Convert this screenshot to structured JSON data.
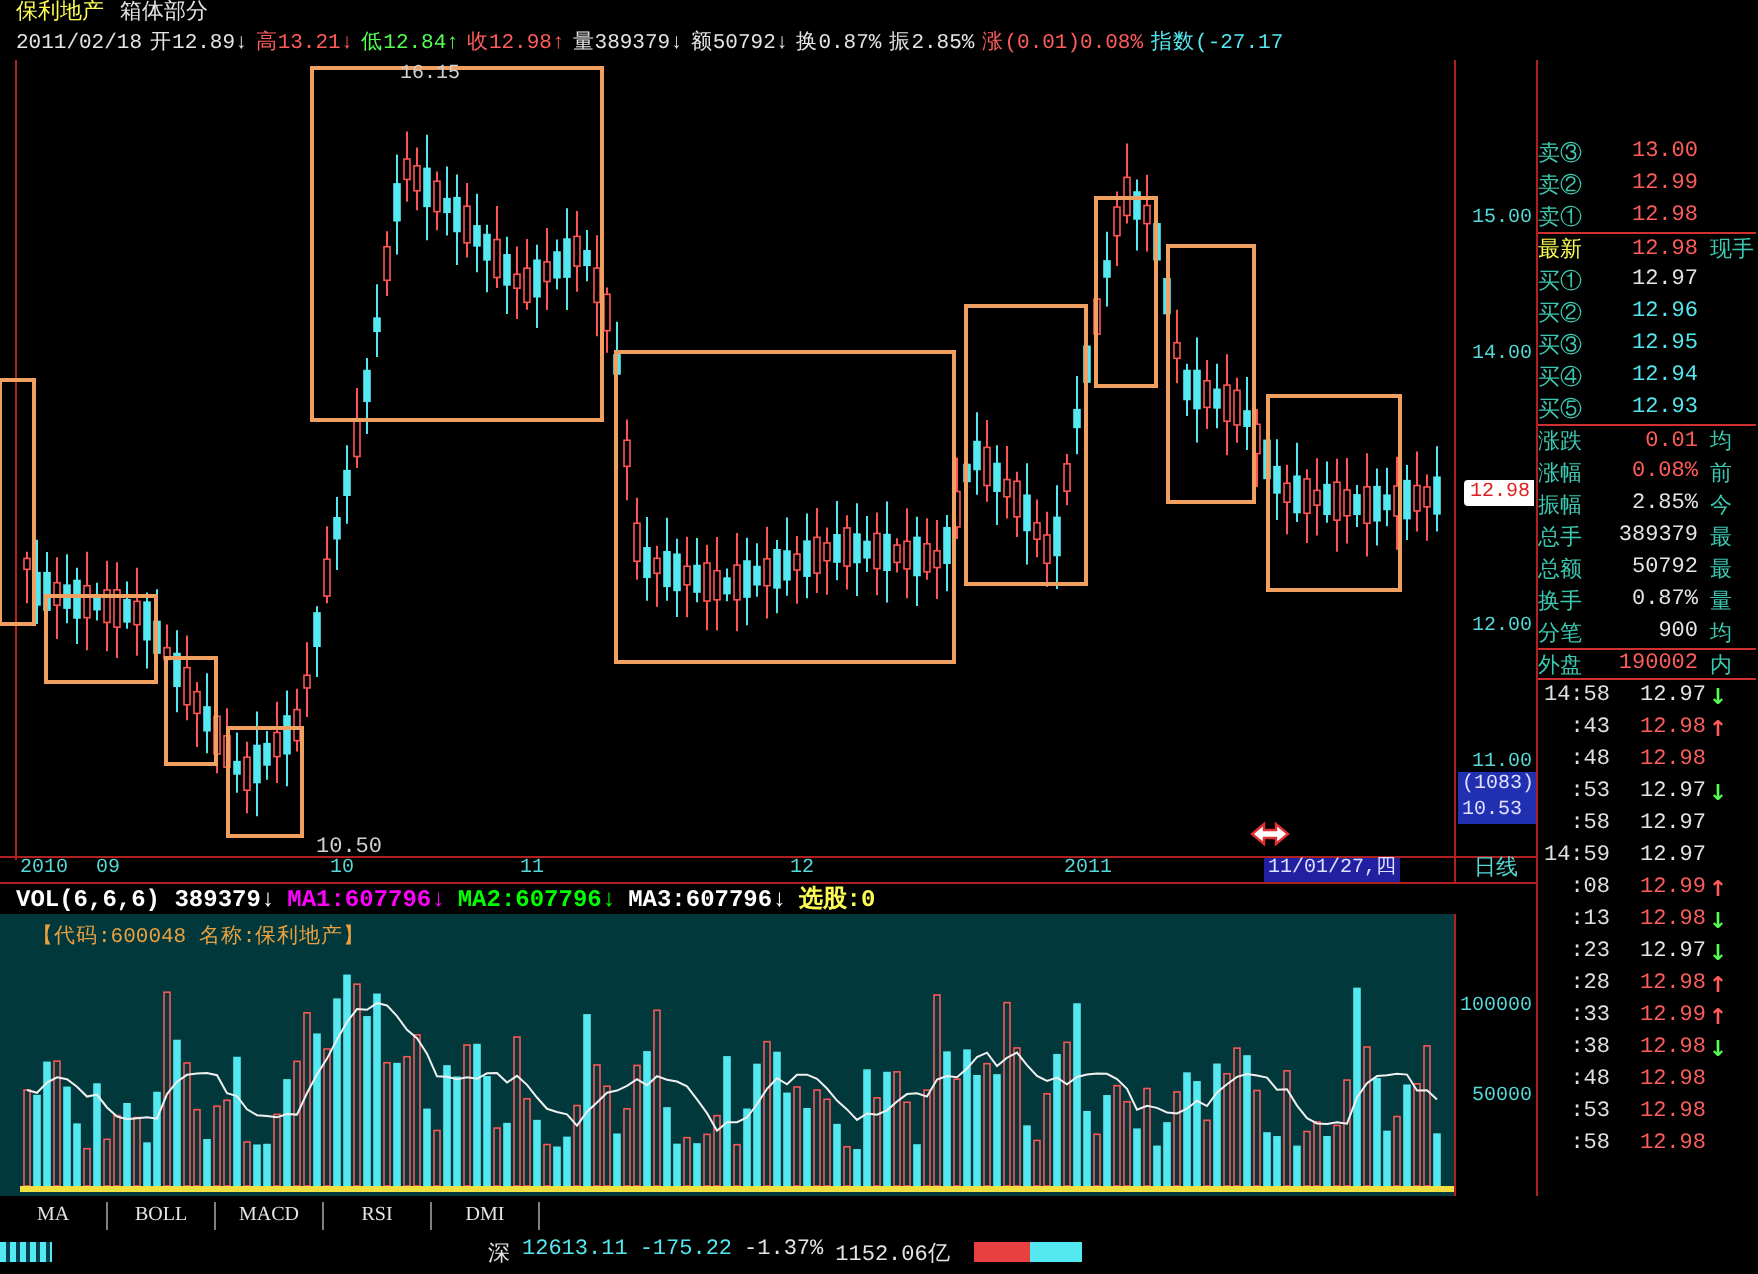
{
  "header": {
    "title": "保利地产",
    "subtitle": "箱体部分",
    "quote": [
      {
        "text": "2011/02/18",
        "color": "#e4e4e4"
      },
      {
        "text": "开12.89↓",
        "color": "#e4e4e4"
      },
      {
        "text": "高13.21↓",
        "color": "#ff5c5c"
      },
      {
        "text": "低12.84↑",
        "color": "#54fc54"
      },
      {
        "text": "收12.98↑",
        "color": "#ff5c5c"
      },
      {
        "text": "量389379↓",
        "color": "#e4e4e4"
      },
      {
        "text": "额50792↓",
        "color": "#e4e4e4"
      },
      {
        "text": "换0.87%",
        "color": "#e4e4e4"
      },
      {
        "text": "振2.85%",
        "color": "#e4e4e4"
      },
      {
        "text": "涨(0.01)0.08%",
        "color": "#ff5c5c"
      },
      {
        "text": "指数(-27.17",
        "color": "#54e8f0"
      }
    ]
  },
  "chart": {
    "high_label": "16.15",
    "low_label": "10.50",
    "price_ticks": [
      "15.00",
      "14.00",
      "12.00",
      "11.00"
    ],
    "last_price": "12.98",
    "cursor_info": [
      "(1083)",
      "10.53"
    ],
    "dates": [
      "2010",
      "09",
      "10",
      "11",
      "12",
      "2011"
    ],
    "cursor_date": "11/01/27,四",
    "period": "日线"
  },
  "volume": {
    "indicator": [
      {
        "text": "VOL(6,6,6) 389379↓",
        "color": "#ffffff"
      },
      {
        "text": "MA1:607796↓",
        "color": "#ff00ff"
      },
      {
        "text": "MA2:607796↓",
        "color": "#00ff00"
      },
      {
        "text": "MA3:607796↓",
        "color": "#ffffff"
      },
      {
        "text": "选股:0",
        "color": "#fcfc54"
      }
    ],
    "caption": "【代码:600048 名称:保利地产】",
    "ticks": [
      "100000",
      "50000"
    ]
  },
  "panel": {
    "asks": [
      {
        "label": "卖③",
        "value": "13.00",
        "color": "#ff5c5c"
      },
      {
        "label": "卖②",
        "value": "12.99",
        "color": "#ff5c5c"
      },
      {
        "label": "卖①",
        "value": "12.98",
        "color": "#ff5c5c"
      }
    ],
    "latest": {
      "label": "最新",
      "value": "12.98",
      "color": "#ff5c5c",
      "side": "现手"
    },
    "bids": [
      {
        "label": "买①",
        "value": "12.97",
        "color": "#e4e4e4"
      },
      {
        "label": "买②",
        "value": "12.96",
        "color": "#54e8f0"
      },
      {
        "label": "买③",
        "value": "12.95",
        "color": "#54e8f0"
      },
      {
        "label": "买④",
        "value": "12.94",
        "color": "#54e8f0"
      },
      {
        "label": "买⑤",
        "value": "12.93",
        "color": "#54e8f0"
      }
    ],
    "stats": [
      {
        "label": "涨跌",
        "value": "0.01",
        "color": "#ff5c5c",
        "side": "均"
      },
      {
        "label": "涨幅",
        "value": "0.08%",
        "color": "#ff5c5c",
        "side": "前"
      },
      {
        "label": "振幅",
        "value": "2.85%",
        "color": "#e4e4e4",
        "side": "今"
      },
      {
        "label": "总手",
        "value": "389379",
        "color": "#e4e4e4",
        "side": "最"
      },
      {
        "label": "总额",
        "value": "50792",
        "color": "#e4e4e4",
        "side": "最"
      },
      {
        "label": "换手",
        "value": "0.87%",
        "color": "#e4e4e4",
        "side": "量"
      },
      {
        "label": "分笔",
        "value": "900",
        "color": "#e4e4e4",
        "side": "均"
      }
    ],
    "outer": {
      "label": "外盘",
      "value": "190002",
      "color": "#ff5c5c",
      "side": "内"
    },
    "trades": [
      {
        "time": "14:58",
        "price": "12.97",
        "color": "#e4e4e4",
        "arrow": {
          "text": "↓",
          "color": "#54fc54"
        }
      },
      {
        "time": ":43",
        "price": "12.98",
        "color": "#ff5c5c",
        "arrow": {
          "text": "↑",
          "color": "#ff5c5c"
        }
      },
      {
        "time": ":48",
        "price": "12.98",
        "color": "#ff5c5c"
      },
      {
        "time": ":53",
        "price": "12.97",
        "color": "#e4e4e4",
        "arrow": {
          "text": "↓",
          "color": "#54fc54"
        }
      },
      {
        "time": ":58",
        "price": "12.97",
        "color": "#e4e4e4"
      },
      {
        "time": "14:59",
        "price": "12.97",
        "color": "#e4e4e4"
      },
      {
        "time": ":08",
        "price": "12.99",
        "color": "#ff5c5c",
        "arrow": {
          "text": "↑",
          "color": "#ff5c5c"
        }
      },
      {
        "time": ":13",
        "price": "12.98",
        "color": "#ff5c5c",
        "arrow": {
          "text": "↓",
          "color": "#54fc54"
        }
      },
      {
        "time": ":23",
        "price": "12.97",
        "color": "#e4e4e4",
        "arrow": {
          "text": "↓",
          "color": "#54fc54"
        }
      },
      {
        "time": ":28",
        "price": "12.98",
        "color": "#ff5c5c",
        "arrow": {
          "text": "↑",
          "color": "#ff5c5c"
        }
      },
      {
        "time": ":33",
        "price": "12.99",
        "color": "#ff5c5c",
        "arrow": {
          "text": "↑",
          "color": "#ff5c5c"
        }
      },
      {
        "time": ":38",
        "price": "12.98",
        "color": "#ff5c5c",
        "arrow": {
          "text": "↓",
          "color": "#54fc54"
        }
      },
      {
        "time": ":48",
        "price": "12.98",
        "color": "#ff5c5c"
      },
      {
        "time": ":53",
        "price": "12.98",
        "color": "#ff5c5c"
      },
      {
        "time": ":58",
        "price": "12.98",
        "color": "#ff5c5c"
      }
    ]
  },
  "tabs": [
    "MA",
    "BOLL",
    "MACD",
    "RSI",
    "DMI"
  ],
  "status": [
    {
      "text": "深",
      "color": "#e4e4e4"
    },
    {
      "text": "12613.11",
      "color": "#54e8f0"
    },
    {
      "text": "-175.22",
      "color": "#54e8f0"
    },
    {
      "text": "-1.37%",
      "color": "#e4e4e4"
    },
    {
      "text": "1152.06亿",
      "color": "#e4e4e4"
    }
  ]
}
